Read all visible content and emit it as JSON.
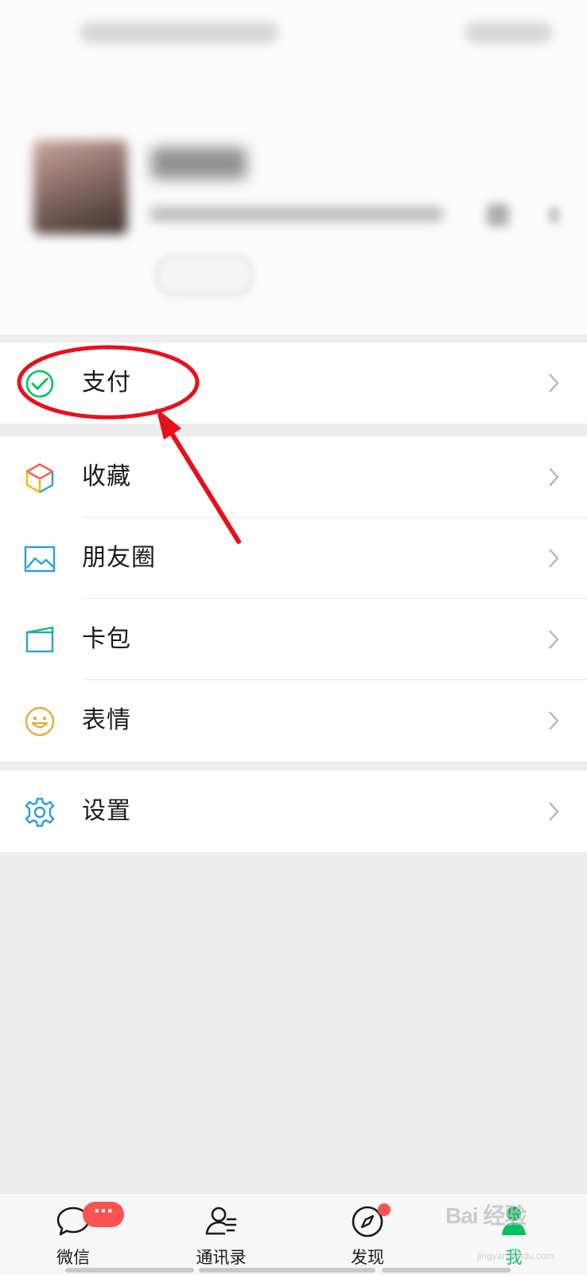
{
  "colors": {
    "accent_green": "#07c160",
    "badge_red": "#fa5151",
    "annotation_red": "#e8101a"
  },
  "menu": {
    "pay": {
      "label": "支付",
      "icon": "wechat-pay-icon"
    },
    "favorites": {
      "label": "收藏",
      "icon": "cube-icon"
    },
    "moments": {
      "label": "朋友圈",
      "icon": "picture-icon"
    },
    "cards": {
      "label": "卡包",
      "icon": "card-wallet-icon"
    },
    "stickers": {
      "label": "表情",
      "icon": "smiley-icon"
    },
    "settings": {
      "label": "设置",
      "icon": "gear-icon"
    }
  },
  "tabbar": {
    "tabs": [
      {
        "label": "微信",
        "icon": "chat-bubble-icon",
        "badge": "···"
      },
      {
        "label": "通讯录",
        "icon": "contacts-icon"
      },
      {
        "label": "发现",
        "icon": "compass-icon"
      },
      {
        "label": "我",
        "icon": "person-icon",
        "active": true
      }
    ]
  },
  "watermark": {
    "text": "Bai 经验",
    "sub": "jingyan.baidu.com"
  }
}
